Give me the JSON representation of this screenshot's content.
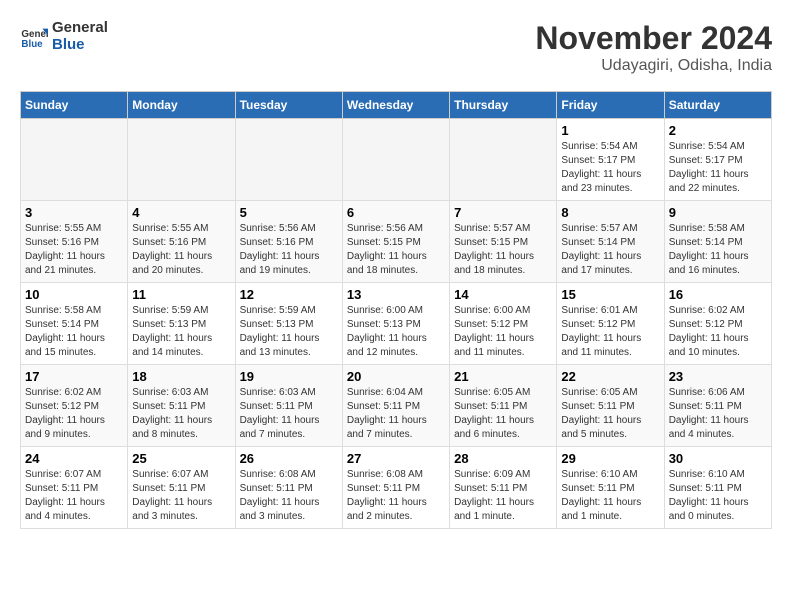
{
  "logo": {
    "line1": "General",
    "line2": "Blue"
  },
  "title": "November 2024",
  "subtitle": "Udayagiri, Odisha, India",
  "weekdays": [
    "Sunday",
    "Monday",
    "Tuesday",
    "Wednesday",
    "Thursday",
    "Friday",
    "Saturday"
  ],
  "weeks": [
    [
      {
        "day": "",
        "info": ""
      },
      {
        "day": "",
        "info": ""
      },
      {
        "day": "",
        "info": ""
      },
      {
        "day": "",
        "info": ""
      },
      {
        "day": "",
        "info": ""
      },
      {
        "day": "1",
        "info": "Sunrise: 5:54 AM\nSunset: 5:17 PM\nDaylight: 11 hours and 23 minutes."
      },
      {
        "day": "2",
        "info": "Sunrise: 5:54 AM\nSunset: 5:17 PM\nDaylight: 11 hours and 22 minutes."
      }
    ],
    [
      {
        "day": "3",
        "info": "Sunrise: 5:55 AM\nSunset: 5:16 PM\nDaylight: 11 hours and 21 minutes."
      },
      {
        "day": "4",
        "info": "Sunrise: 5:55 AM\nSunset: 5:16 PM\nDaylight: 11 hours and 20 minutes."
      },
      {
        "day": "5",
        "info": "Sunrise: 5:56 AM\nSunset: 5:16 PM\nDaylight: 11 hours and 19 minutes."
      },
      {
        "day": "6",
        "info": "Sunrise: 5:56 AM\nSunset: 5:15 PM\nDaylight: 11 hours and 18 minutes."
      },
      {
        "day": "7",
        "info": "Sunrise: 5:57 AM\nSunset: 5:15 PM\nDaylight: 11 hours and 18 minutes."
      },
      {
        "day": "8",
        "info": "Sunrise: 5:57 AM\nSunset: 5:14 PM\nDaylight: 11 hours and 17 minutes."
      },
      {
        "day": "9",
        "info": "Sunrise: 5:58 AM\nSunset: 5:14 PM\nDaylight: 11 hours and 16 minutes."
      }
    ],
    [
      {
        "day": "10",
        "info": "Sunrise: 5:58 AM\nSunset: 5:14 PM\nDaylight: 11 hours and 15 minutes."
      },
      {
        "day": "11",
        "info": "Sunrise: 5:59 AM\nSunset: 5:13 PM\nDaylight: 11 hours and 14 minutes."
      },
      {
        "day": "12",
        "info": "Sunrise: 5:59 AM\nSunset: 5:13 PM\nDaylight: 11 hours and 13 minutes."
      },
      {
        "day": "13",
        "info": "Sunrise: 6:00 AM\nSunset: 5:13 PM\nDaylight: 11 hours and 12 minutes."
      },
      {
        "day": "14",
        "info": "Sunrise: 6:00 AM\nSunset: 5:12 PM\nDaylight: 11 hours and 11 minutes."
      },
      {
        "day": "15",
        "info": "Sunrise: 6:01 AM\nSunset: 5:12 PM\nDaylight: 11 hours and 11 minutes."
      },
      {
        "day": "16",
        "info": "Sunrise: 6:02 AM\nSunset: 5:12 PM\nDaylight: 11 hours and 10 minutes."
      }
    ],
    [
      {
        "day": "17",
        "info": "Sunrise: 6:02 AM\nSunset: 5:12 PM\nDaylight: 11 hours and 9 minutes."
      },
      {
        "day": "18",
        "info": "Sunrise: 6:03 AM\nSunset: 5:11 PM\nDaylight: 11 hours and 8 minutes."
      },
      {
        "day": "19",
        "info": "Sunrise: 6:03 AM\nSunset: 5:11 PM\nDaylight: 11 hours and 7 minutes."
      },
      {
        "day": "20",
        "info": "Sunrise: 6:04 AM\nSunset: 5:11 PM\nDaylight: 11 hours and 7 minutes."
      },
      {
        "day": "21",
        "info": "Sunrise: 6:05 AM\nSunset: 5:11 PM\nDaylight: 11 hours and 6 minutes."
      },
      {
        "day": "22",
        "info": "Sunrise: 6:05 AM\nSunset: 5:11 PM\nDaylight: 11 hours and 5 minutes."
      },
      {
        "day": "23",
        "info": "Sunrise: 6:06 AM\nSunset: 5:11 PM\nDaylight: 11 hours and 4 minutes."
      }
    ],
    [
      {
        "day": "24",
        "info": "Sunrise: 6:07 AM\nSunset: 5:11 PM\nDaylight: 11 hours and 4 minutes."
      },
      {
        "day": "25",
        "info": "Sunrise: 6:07 AM\nSunset: 5:11 PM\nDaylight: 11 hours and 3 minutes."
      },
      {
        "day": "26",
        "info": "Sunrise: 6:08 AM\nSunset: 5:11 PM\nDaylight: 11 hours and 3 minutes."
      },
      {
        "day": "27",
        "info": "Sunrise: 6:08 AM\nSunset: 5:11 PM\nDaylight: 11 hours and 2 minutes."
      },
      {
        "day": "28",
        "info": "Sunrise: 6:09 AM\nSunset: 5:11 PM\nDaylight: 11 hours and 1 minute."
      },
      {
        "day": "29",
        "info": "Sunrise: 6:10 AM\nSunset: 5:11 PM\nDaylight: 11 hours and 1 minute."
      },
      {
        "day": "30",
        "info": "Sunrise: 6:10 AM\nSunset: 5:11 PM\nDaylight: 11 hours and 0 minutes."
      }
    ]
  ]
}
